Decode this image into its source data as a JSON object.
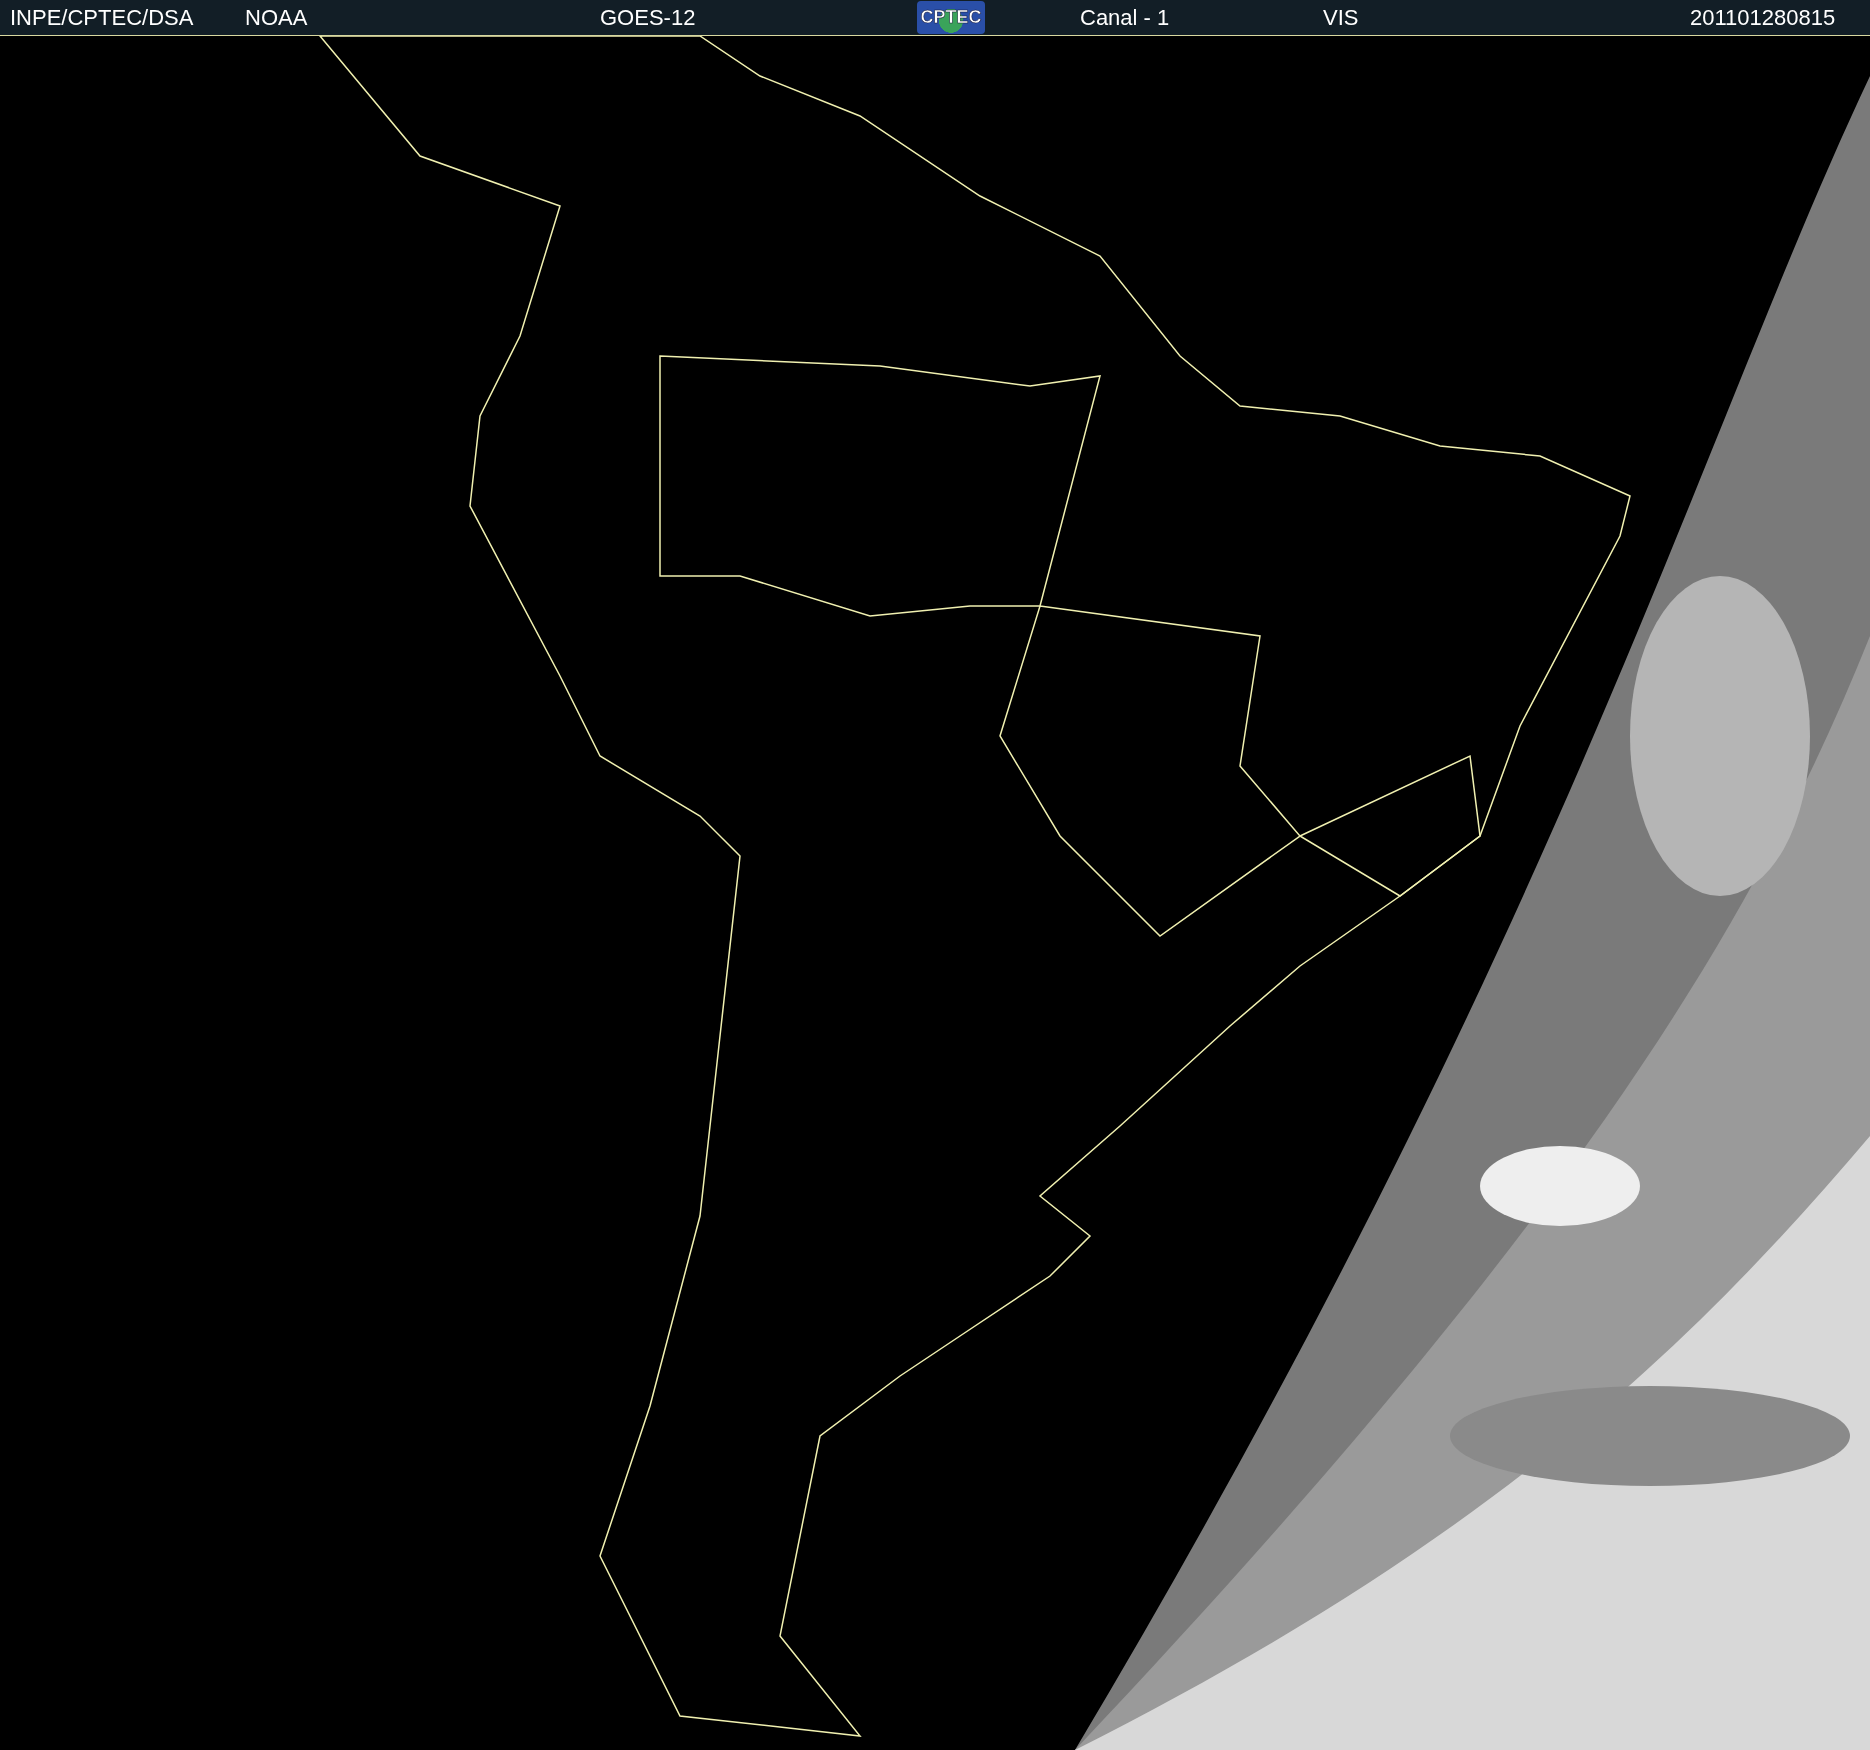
{
  "header": {
    "labels": [
      {
        "kind": "text",
        "text": "INPE/CPTEC/DSA"
      },
      {
        "kind": "text",
        "text": "NOAA"
      },
      {
        "kind": "text",
        "text": "GOES-12"
      },
      {
        "kind": "logo",
        "text": "CPTEC"
      },
      {
        "kind": "text",
        "text": "Canal - 1"
      },
      {
        "kind": "text",
        "text": "VIS"
      },
      {
        "kind": "text",
        "text": "201101280815"
      }
    ]
  }
}
